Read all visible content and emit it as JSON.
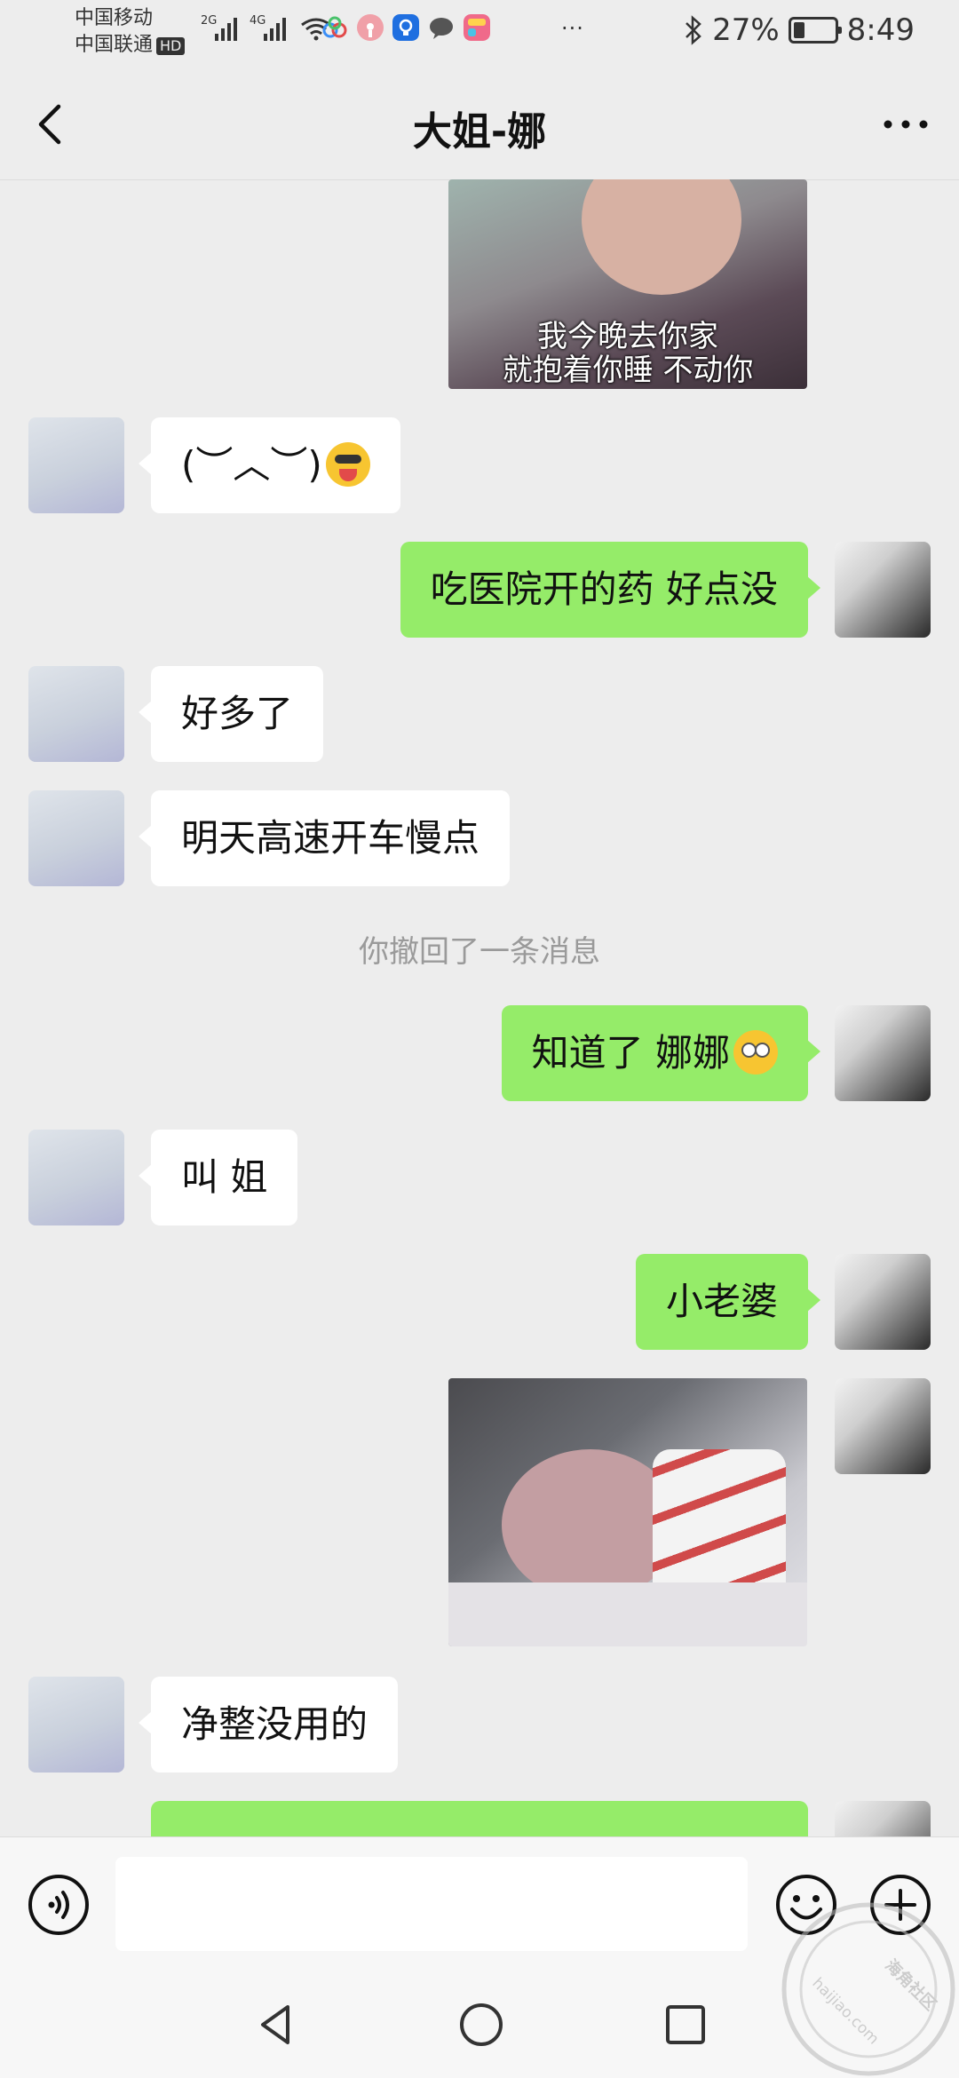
{
  "status_bar": {
    "carrier_1": "中国移动",
    "carrier_2": "中国联通",
    "hd_badge": "HD",
    "signal_tag_1": "2G",
    "signal_tag_2": "4G",
    "more_indicator": "···",
    "battery_percent": "27%",
    "battery_level": 0.27,
    "time": "8:49"
  },
  "header": {
    "title": "大姐-娜"
  },
  "messages": [
    {
      "side": "out",
      "type": "image",
      "caption_line_1": "我今晚去你家",
      "caption_line_2": "就抱着你睡  不动你"
    },
    {
      "side": "in",
      "type": "text",
      "text": "(︶︿︶)",
      "emoji": "tongue-face-emoji"
    },
    {
      "side": "out",
      "type": "text",
      "text": "吃医院开的药  好点没"
    },
    {
      "side": "in",
      "type": "text",
      "text": "好多了"
    },
    {
      "side": "in",
      "type": "text",
      "text": "明天高速开车慢点"
    },
    {
      "side": "system",
      "type": "system",
      "text": "你撤回了一条消息"
    },
    {
      "side": "out",
      "type": "text",
      "text": "知道了 娜娜",
      "emoji": "flushed-face-emoji"
    },
    {
      "side": "in",
      "type": "text",
      "text": "叫 姐"
    },
    {
      "side": "out",
      "type": "text",
      "text": "小老婆"
    },
    {
      "side": "out",
      "type": "image"
    },
    {
      "side": "in",
      "type": "text",
      "text": "净整没用的"
    }
  ],
  "input": {
    "value": ""
  },
  "colors": {
    "background": "#ededed",
    "outgoing_bubble": "#95ec69",
    "incoming_bubble": "#ffffff",
    "system_text": "#9a9a9a"
  },
  "icons": {
    "back": "chevron-left-icon",
    "more": "more-dots-icon",
    "voice": "voice-icon",
    "emoji": "smiley-icon",
    "plus": "plus-icon",
    "nav_back": "triangle-back-icon",
    "nav_home": "circle-home-icon",
    "nav_recent": "square-recent-icon",
    "watermark": "watermark-stamp-icon"
  },
  "watermark": {
    "text": "海角社区",
    "url": "haijiao.com"
  }
}
